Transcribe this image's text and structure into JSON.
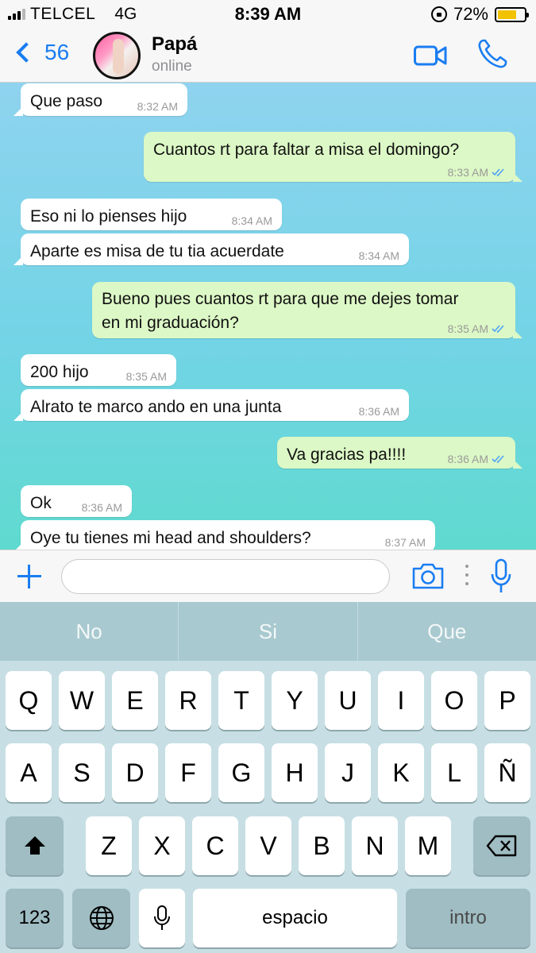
{
  "status_bar": {
    "carrier": "TELCEL",
    "network": "4G",
    "time": "8:39 AM",
    "battery": "72%",
    "battery_level": 0.72
  },
  "header": {
    "back_count": "56",
    "contact_name": "Papá",
    "contact_status": "online"
  },
  "messages": [
    {
      "dir": "in",
      "text": "Que paso",
      "time": "8:32 AM"
    },
    {
      "dir": "out",
      "text": "Cuantos rt para faltar a misa el domingo?",
      "time": "8:33 AM",
      "read": true
    },
    {
      "dir": "in",
      "text": "Eso ni lo pienses hijo",
      "time": "8:34 AM"
    },
    {
      "dir": "in",
      "text": "Aparte es misa de tu tia acuerdate",
      "time": "8:34 AM"
    },
    {
      "dir": "out",
      "text_line1": "Bueno pues cuantos rt para que me dejes tomar",
      "text_line2": "en mi graduación?",
      "time": "8:35 AM",
      "read": true
    },
    {
      "dir": "in",
      "text": "200 hijo",
      "time": "8:35 AM"
    },
    {
      "dir": "in",
      "text": "Alrato te marco ando en una junta",
      "time": "8:36 AM"
    },
    {
      "dir": "out",
      "text": "Va gracias pa!!!!",
      "time": "8:36 AM",
      "read": true
    },
    {
      "dir": "in",
      "text": "Ok",
      "time": "8:36 AM"
    },
    {
      "dir": "in",
      "text": "Oye tu tienes mi head and shoulders?",
      "time": "8:37 AM"
    }
  ],
  "input": {
    "value": "",
    "placeholder": ""
  },
  "keyboard": {
    "suggestions": [
      "No",
      "Si",
      "Que"
    ],
    "row1": [
      "Q",
      "W",
      "E",
      "R",
      "T",
      "Y",
      "U",
      "I",
      "O",
      "P"
    ],
    "row2": [
      "A",
      "S",
      "D",
      "F",
      "G",
      "H",
      "J",
      "K",
      "L",
      "Ñ"
    ],
    "row3": [
      "Z",
      "X",
      "C",
      "V",
      "B",
      "N",
      "M"
    ],
    "numbers_key": "123",
    "space_key": "espacio",
    "return_key": "intro"
  },
  "colors": {
    "accent": "#1a7df1",
    "outgoing_bubble": "#dcf8c6",
    "incoming_bubble": "#ffffff",
    "read_ticks": "#4fa3f7",
    "battery_fill": "#f2c200"
  },
  "icons": [
    "signal-icon",
    "rotation-lock-icon",
    "battery-icon",
    "back-chevron-icon",
    "video-call-icon",
    "phone-icon",
    "plus-icon",
    "camera-icon",
    "more-dots-icon",
    "microphone-icon",
    "shift-icon",
    "backspace-icon",
    "globe-icon",
    "keyboard-mic-icon",
    "read-ticks-icon"
  ]
}
